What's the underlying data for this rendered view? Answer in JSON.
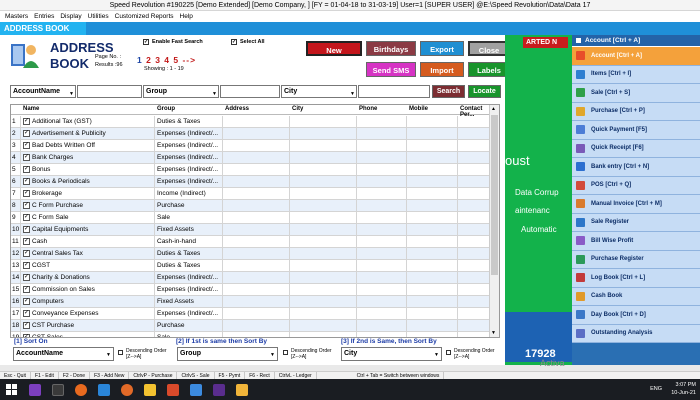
{
  "window": {
    "title": "Speed Revolution #190225  [Demo Extended]  [Demo Company, ] [FY = 01-04-18 to 31-03-19] User=1 [SUPER USER]  @E:\\Speed Revolution\\Data\\Data 17"
  },
  "menu": [
    "Masters",
    "Entries",
    "Display",
    "Utilities",
    "Customized Reports",
    "Help"
  ],
  "tab_label": "ADDRESS BOOK",
  "form": {
    "title_line1": "ADDRESS",
    "title_line2": "BOOK",
    "page_no_label": "Page No. :",
    "results_label": "Results :96",
    "pages": "1 2 3 4 5 -->",
    "pages_current": "1",
    "pages_rest": "2 3 4 5 -->",
    "showing": "Showing :  1 - 19",
    "fast_search": "Enable Fast Search",
    "select_all": "Select All",
    "check_mark": "✓"
  },
  "buttons": {
    "new": "New",
    "birthdays": "Birthdays",
    "export": "Export",
    "close": "Close",
    "send_sms": "Send SMS",
    "import": "Import",
    "labels": "Labels",
    "search": "Search",
    "locate": "Locate"
  },
  "search": {
    "field1": "AccountName",
    "field2": "Group",
    "field3": "City"
  },
  "grid": {
    "headers": [
      "Name",
      "Group",
      "Address",
      "City",
      "Phone",
      "Mobile",
      "Contact Per..."
    ],
    "rows": [
      [
        "1",
        "Additional Tax (GST)",
        "Duties & Taxes"
      ],
      [
        "2",
        "Advertisement & Publicity",
        "Expenses (Indirect/..."
      ],
      [
        "3",
        "Bad Debts Written Off",
        "Expenses (Indirect/..."
      ],
      [
        "4",
        "Bank Charges",
        "Expenses (Indirect/..."
      ],
      [
        "5",
        "Bonus",
        "Expenses (Indirect/..."
      ],
      [
        "6",
        "Books & Periodicals",
        "Expenses (Indirect/..."
      ],
      [
        "7",
        "Brokerage",
        "Income (Indirect)"
      ],
      [
        "8",
        "C Form Purchase",
        "Purchase"
      ],
      [
        "9",
        "C Form Sale",
        "Sale"
      ],
      [
        "10",
        "Capital Equipments",
        "Fixed Assets"
      ],
      [
        "11",
        "Cash",
        "Cash-in-hand"
      ],
      [
        "12",
        "Central Sales Tax",
        "Duties & Taxes"
      ],
      [
        "13",
        "CGST",
        "Duties & Taxes"
      ],
      [
        "14",
        "Charity & Donations",
        "Expenses (Indirect/..."
      ],
      [
        "15",
        "Commission on Sales",
        "Expenses (Indirect/..."
      ],
      [
        "16",
        "Computers",
        "Fixed Assets"
      ],
      [
        "17",
        "Conveyance Expenses",
        "Expenses (Indirect/..."
      ],
      [
        "18",
        "CST Purchase",
        "Purchase"
      ],
      [
        "19",
        "CST Sales",
        "Sale"
      ]
    ]
  },
  "sort": {
    "label1": "[1] Sort On",
    "value1": "AccountName",
    "label2": "[2]  If 1st is same then Sort By",
    "value2": "Group",
    "label3": "[3] If 2nd is Same, then Sort By",
    "value3": "City",
    "descending": "Descending Order",
    "descending_sub": "[Z-->A]"
  },
  "banner": {
    "top": "ARTED N",
    "text1": "oust",
    "text2": "Data Corrup",
    "text3": "aintenanc",
    "text4": "Automatic",
    "number": "17928"
  },
  "sidebar": {
    "header": "Account [Ctrl + A]",
    "items": [
      {
        "label": "Account [Ctrl + A]",
        "active": true,
        "color": "#e84d2a"
      },
      {
        "label": "Items [Ctrl + I]",
        "color": "#2f7fd1"
      },
      {
        "label": "Sale [Ctrl + S]",
        "color": "#2fa04a"
      },
      {
        "label": "Purchase [Ctrl + P]",
        "color": "#e0a72c"
      },
      {
        "label": "Quick Payment [F5]",
        "color": "#4c7dd6"
      },
      {
        "label": "Quick Receipt [F6]",
        "color": "#7a5ab8"
      },
      {
        "label": "Bank entry [Ctrl + N]",
        "color": "#2d6fd0"
      },
      {
        "label": "POS [Ctrl + Q]",
        "color": "#d24b3c"
      },
      {
        "label": "Manual Invoice [Ctrl + M]",
        "color": "#d97b2e"
      },
      {
        "label": "Sale Register",
        "color": "#2e77c9"
      },
      {
        "label": "Bill Wise Profit",
        "color": "#8a5bc7"
      },
      {
        "label": "Purchase Register",
        "color": "#2b9a5a"
      },
      {
        "label": "Log Book [Ctrl + L]",
        "color": "#c23b3b"
      },
      {
        "label": "Cash Book",
        "color": "#e09a2a"
      },
      {
        "label": "Day Book [Ctrl + D]",
        "color": "#3b78c8"
      },
      {
        "label": "Outstanding Analysis",
        "color": "#5b6ec5"
      }
    ]
  },
  "statusbar": [
    "Esc - Quit",
    "F1 - Edit",
    "F2 - Done",
    "F3 - Add New",
    "CtrlvP - Purchase",
    "CtrlvS - Sale",
    "F5 - Pymt",
    "F6 - Rect",
    "CtrlvL - Ledger",
    "Ctrl + Tab = Switch between windows"
  ],
  "taskbar": {
    "lang": "ENG",
    "time": "3:07 PM",
    "date": "10-Jun-21"
  },
  "watermark": "Activa"
}
